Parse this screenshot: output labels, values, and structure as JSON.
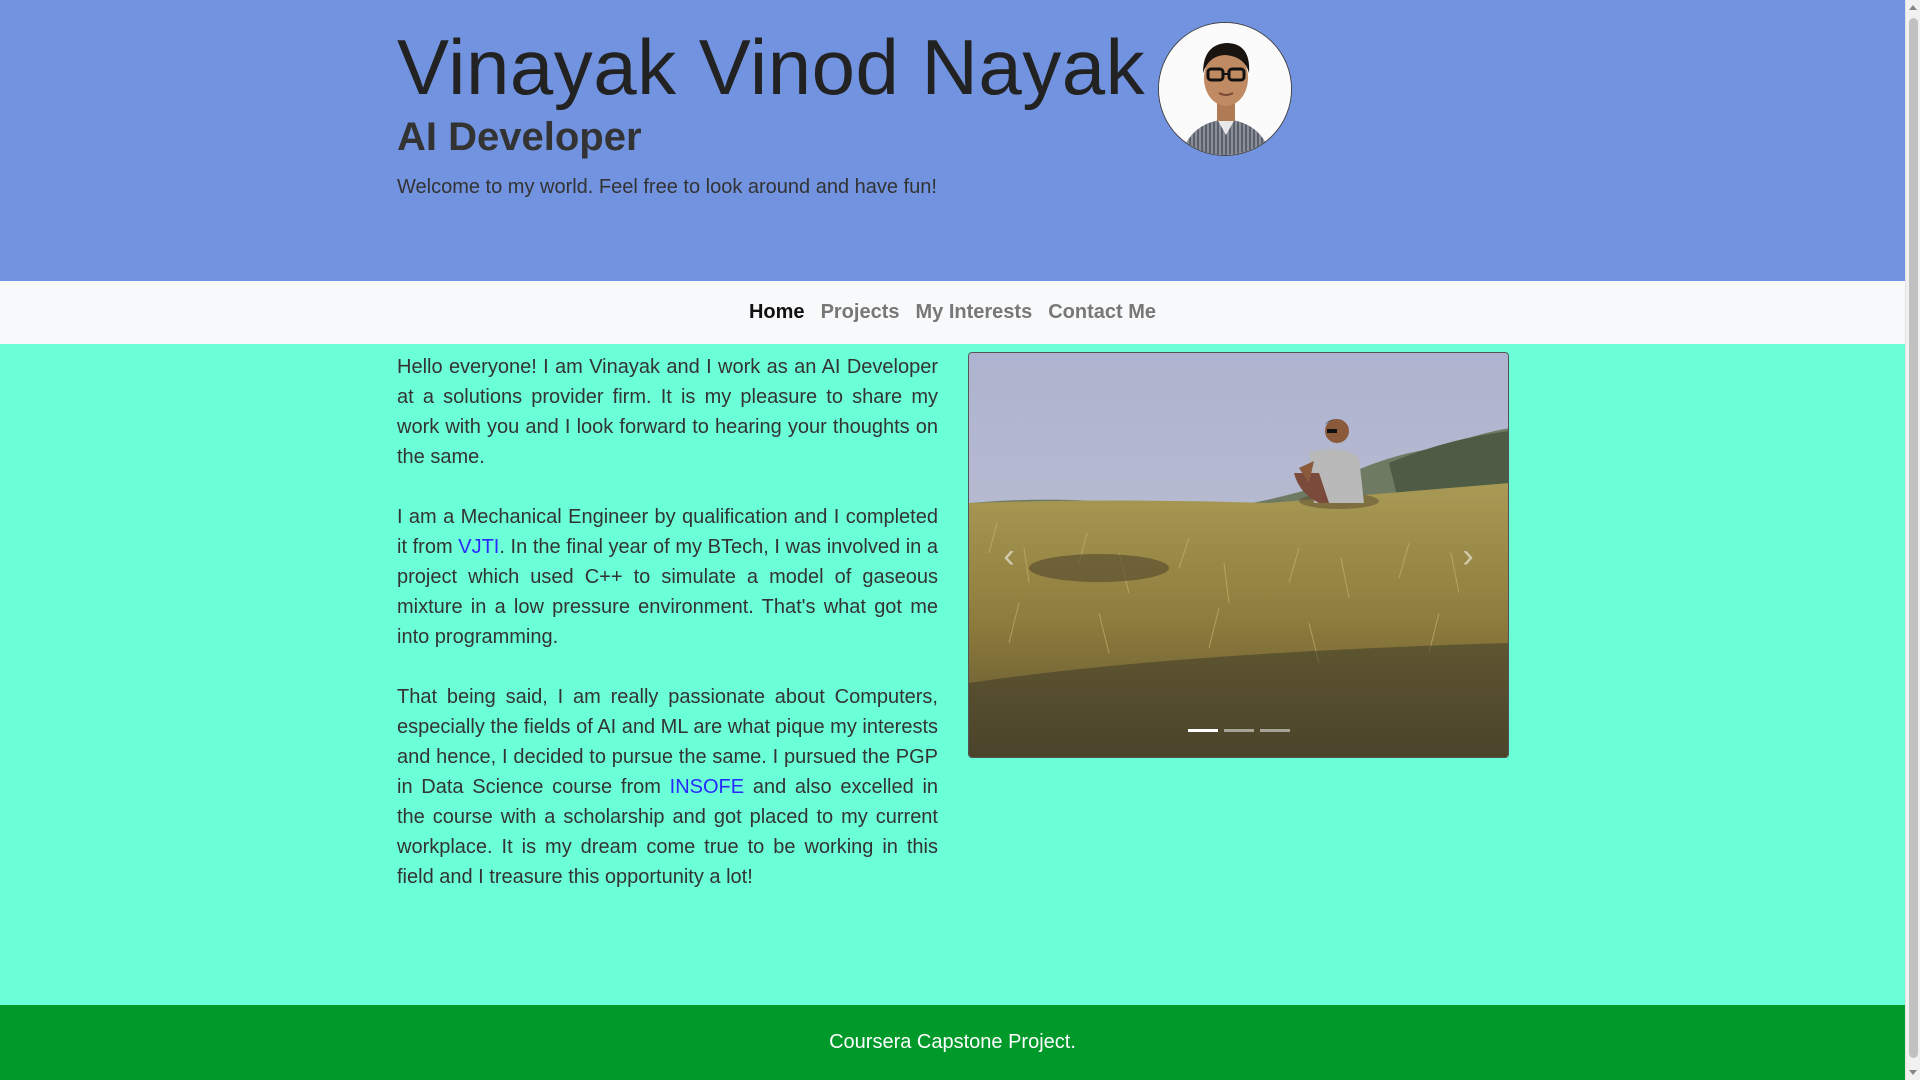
{
  "header": {
    "name": "Vinayak Vinod Nayak",
    "role": "AI Developer",
    "welcome": "Welcome to my world. Feel free to look around and have fun!"
  },
  "nav": {
    "items": [
      {
        "label": "Home",
        "active": true
      },
      {
        "label": "Projects"
      },
      {
        "label": "My Interests"
      },
      {
        "label": "Contact Me"
      }
    ]
  },
  "about": {
    "p1": "Hello everyone! I am Vinayak and I work as an AI Developer at a solutions provider firm. It is my pleasure to share my work with you and I look forward to hearing your thoughts on the same.",
    "p2_before": "I am a Mechanical Engineer by qualification and I completed it from ",
    "p2_link": "VJTI",
    "p2_after": ". In the final year of my BTech, I was involved in a project which used C++ to simulate a model of gaseous mixture in a low pressure environment. That's what got me into programming.",
    "p3_before": "That being said, I am really passionate about Computers, especially the fields of AI and ML are what pique my interests and hence, I decided to pursue the same. I pursued the PGP in Data Science course from ",
    "p3_link": "INSOFE",
    "p3_after": " and also excelled in the course with a scholarship and got placed to my current workplace. It is my dream come true to be working in this field and I treasure this opportunity a lot!"
  },
  "carousel": {
    "prev_icon": "‹",
    "next_icon": "›",
    "slide_count": 3,
    "active_slide": 1
  },
  "footer": {
    "text": "Coursera Capstone Project."
  },
  "colors": {
    "header_bg": "#7193e0",
    "page_bg": "#6affd6",
    "footer_bg": "#009a2b",
    "link": "#2a2aff"
  }
}
